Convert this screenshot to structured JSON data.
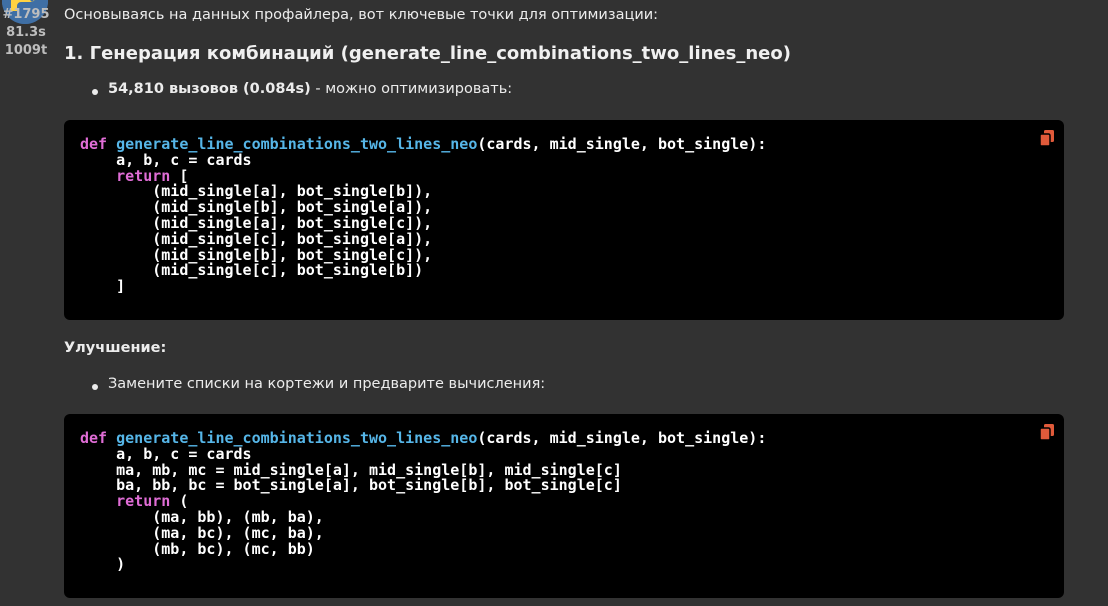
{
  "sidebar": {
    "message_id": "#1795",
    "duration": "81.3s",
    "tokens": "1009t"
  },
  "message": {
    "intro": "Основываясь на данных профайлера, вот ключевые точки для оптимизации:",
    "heading": "1. Генерация комбинаций (generate_line_combinations_two_lines_neo)",
    "bullet1_bold": "54,810 вызовов (0.084s)",
    "bullet1_rest": " - можно оптимизировать:",
    "improvement_label": "Улучшение:",
    "bullet2": "Замените списки на кортежи и предварите вычисления:"
  },
  "code1": {
    "kw_def": "def",
    "fn_name": "generate_line_combinations_two_lines_neo",
    "signature": "(cards, mid_single, bot_single):",
    "line_unpack": "    a, b, c = cards",
    "kw_return": "return",
    "return_open": " [",
    "body": "        (mid_single[a], bot_single[b]),\n        (mid_single[b], bot_single[a]),\n        (mid_single[a], bot_single[c]),\n        (mid_single[c], bot_single[a]),\n        (mid_single[b], bot_single[c]),\n        (mid_single[c], bot_single[b])\n    ]"
  },
  "code2": {
    "kw_def": "def",
    "fn_name": "generate_line_combinations_two_lines_neo",
    "signature": "(cards, mid_single, bot_single):",
    "line_unpack": "    a, b, c = cards\n    ma, mb, mc = mid_single[a], mid_single[b], mid_single[c]\n    ba, bb, bc = bot_single[a], bot_single[b], bot_single[c]",
    "kw_return": "return",
    "return_open": " (",
    "body": "        (ma, bb), (mb, ba),\n        (ma, bc), (mc, ba),\n        (mb, bc), (mc, bb)\n    )"
  },
  "colors": {
    "background": "#323232",
    "code_background": "#000000",
    "keyword": "#e06dd6",
    "function": "#56b6e8",
    "copy_icon": "#e05a3a"
  }
}
